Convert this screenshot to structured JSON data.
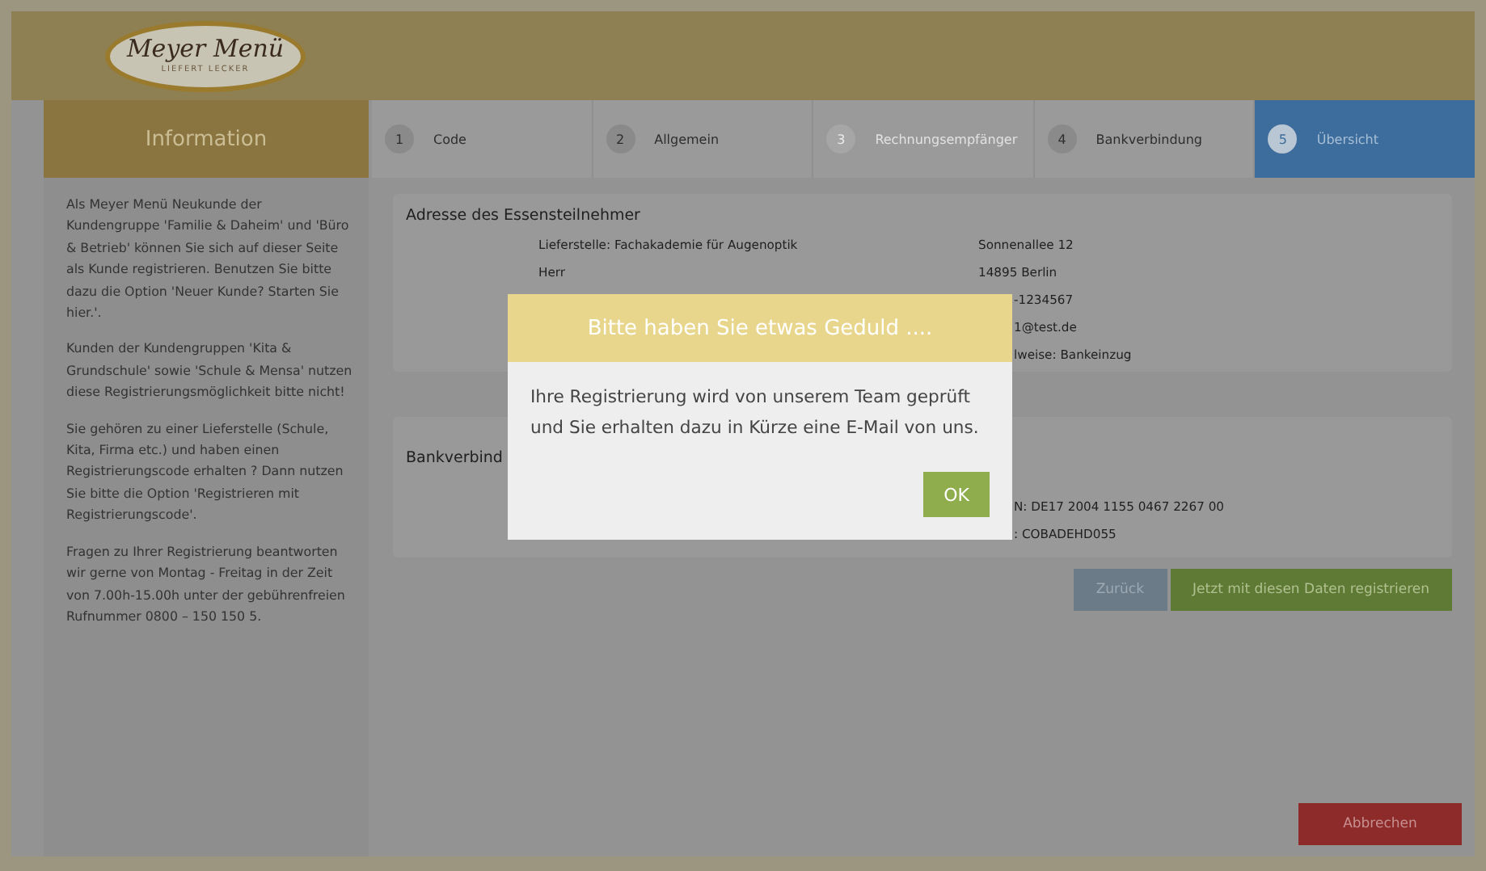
{
  "logo": {
    "name": "Meyer Menü",
    "tagline": "LIEFERT LECKER"
  },
  "sidebar": {
    "title": "Information",
    "paragraphs": [
      "Als Meyer Menü Neukunde der Kundengruppe 'Familie & Daheim' und 'Büro & Betrieb' können Sie sich auf dieser Seite als Kunde registrieren. Benutzen Sie bitte dazu die Option 'Neuer Kunde? Starten Sie hier.'.",
      "Kunden der Kundengruppen 'Kita & Grundschule' sowie 'Schule & Mensa' nutzen diese Registrierungsmöglichkeit bitte nicht!",
      "Sie gehören zu einer Lieferstelle (Schule, Kita, Firma etc.) und haben einen Registrierungscode erhalten ? Dann nutzen Sie bitte die Option 'Registrieren mit Registrierungscode'.",
      "Fragen zu Ihrer Registrierung beantworten wir gerne von Montag - Freitag in der Zeit von 7.00h-15.00h unter der gebührenfreien Rufnummer 0800 – 150 150 5."
    ]
  },
  "steps": [
    {
      "number": "1",
      "label": "Code",
      "selected": false,
      "disabled": false
    },
    {
      "number": "2",
      "label": "Allgemein",
      "selected": false,
      "disabled": false
    },
    {
      "number": "3",
      "label": "Rechnungsempfänger",
      "selected": false,
      "disabled": true
    },
    {
      "number": "4",
      "label": "Bankverbindung",
      "selected": false,
      "disabled": false
    },
    {
      "number": "5",
      "label": "Übersicht",
      "selected": true,
      "disabled": false
    }
  ],
  "address_card": {
    "title": "Adresse des Essensteilnehmer",
    "left": [
      "Lieferstelle: Fachakademie für Augenoptik",
      "Herr"
    ],
    "right": [
      {
        "text": "Sonnenallee 12",
        "kind": "full"
      },
      {
        "text": "14895 Berlin",
        "kind": "full"
      },
      {
        "text": "-1234567",
        "kind": "partial"
      },
      {
        "text": "1@test.de",
        "kind": "partial"
      },
      {
        "text": "lweise: Bankeinzug",
        "kind": "partial"
      }
    ]
  },
  "bank_card": {
    "title": "Bankverbind",
    "right": [
      {
        "text": "N: DE17 2004 1155 0467 2267 00",
        "kind": "partial"
      },
      {
        "text": ":   COBADEHD055",
        "kind": "partial"
      }
    ]
  },
  "buttons": {
    "back": "Zurück",
    "submit": "Jetzt mit diesen Daten registrieren",
    "cancel": "Abbrechen"
  },
  "modal": {
    "title": "Bitte haben Sie etwas Geduld ....",
    "message": "Ihre Registrierung wird von unserem Team geprüft und Sie erhalten dazu in Kürze eine E-Mail von uns.",
    "ok": "OK"
  }
}
